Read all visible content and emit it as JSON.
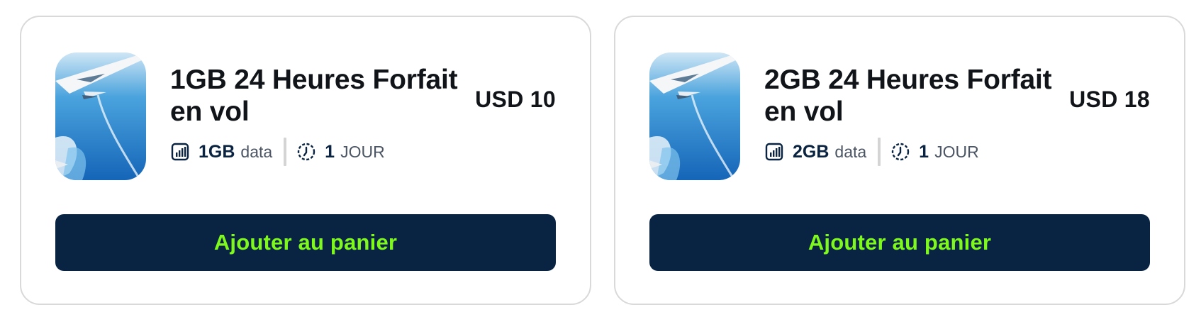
{
  "plans": [
    {
      "title": "1GB 24 Heures Forfait en vol",
      "price": "USD 10",
      "data_value": "1GB",
      "data_unit": "data",
      "duration_value": "1",
      "duration_unit": "JOUR",
      "button_label": "Ajouter au panier",
      "image_icon": "airplane-wing-image"
    },
    {
      "title": "2GB 24 Heures Forfait en vol",
      "price": "USD 18",
      "data_value": "2GB",
      "data_unit": "data",
      "duration_value": "1",
      "duration_unit": "JOUR",
      "button_label": "Ajouter au panier",
      "image_icon": "airplane-wing-image"
    }
  ],
  "icons": {
    "data": "signal-bars-icon",
    "duration": "clock-icon"
  },
  "colors": {
    "button_bg": "#082442",
    "button_text": "#7ff81e",
    "title_text": "#111418",
    "spec_value": "#0a2340",
    "card_border": "#d9d9d9"
  }
}
